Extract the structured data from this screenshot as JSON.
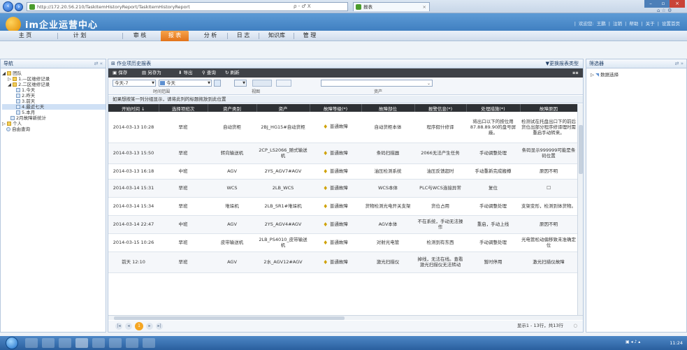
{
  "browser": {
    "address": "http://172.20.56.210/TaskItemHistoryReport/TaskItemHistoryReport",
    "address_controls": "ρ - ♂ X",
    "tab_title": "报表"
  },
  "app": {
    "title": "im企业运营中心",
    "top_links": "| 欢迎您: 王鹏 | 注销 | 帮助 | 关于 | 设置首页"
  },
  "menu": [
    {
      "label": "主 页"
    },
    {
      "label": "计 划"
    },
    {
      "label": "审 核"
    },
    {
      "label": "报 表"
    },
    {
      "label": "分 析"
    },
    {
      "label": "日 志"
    },
    {
      "label": "知识库"
    },
    {
      "label": "管 理"
    }
  ],
  "nav": {
    "title": "导航",
    "tree": [
      {
        "label": "团队"
      },
      {
        "label": "1.—区维修记录"
      },
      {
        "label": "2.二区维修记录"
      },
      {
        "label": "1.今天"
      },
      {
        "label": "2.昨天"
      },
      {
        "label": "3.前天"
      },
      {
        "label": "4.最近七天"
      },
      {
        "label": "5.本月"
      },
      {
        "label": "2月故障新统计"
      },
      {
        "label": "个人"
      },
      {
        "label": "自由查询"
      }
    ]
  },
  "report": {
    "title": "作业项历史报表",
    "change_type": "▼更换报表类型",
    "toolbar": {
      "save": "保存",
      "save_as": "另存为",
      "export": "导出",
      "query": "查询",
      "refresh": "刷新"
    },
    "filters": {
      "from": "今天-7",
      "to": "今天",
      "time_caption": "时间范围",
      "view_caption": "视图",
      "asset_caption": "资产"
    },
    "group_hint": "如果想按某一列分组显示，请将此列的标题拖放到此位置",
    "columns": [
      "开始时间 ↓",
      "选择项班次",
      "资产类别",
      "资产",
      "故障等级(*)",
      "故障部位",
      "报警信息(*)",
      "处理措施(*)",
      "故障原因"
    ],
    "rows": [
      [
        "2014-03-13 10:28",
        "早班",
        "自动货柜",
        "2BJ_HG15#自动货柜",
        "普通故障",
        "自动货柜本体",
        "程序假什修译",
        "将出口以下的按位用87.88.89.90的盘号屏蔽。",
        "检测试在托盘出口下的前后货位出部分程序修译理时需重启手动转来。"
      ],
      [
        "2014-03-13 15:50",
        "早班",
        "转向输送机",
        "2CP_LS2066_随式输送机",
        "普通故障",
        "条码扫描器",
        "2066无法产生任务",
        "手动调整处理",
        "条码显示999999可能是条码位置"
      ],
      [
        "2014-03-13 16:18",
        "中班",
        "AGV",
        "2YS_AGV7#AGV",
        "普通故障",
        "油压检测系统",
        "油压反馈超时",
        "手动重新完成搬樽",
        "原因不明"
      ],
      [
        "2014-03-14 15:31",
        "早班",
        "WCS",
        "2LB_WCS",
        "普通故障",
        "WCS本体",
        "PLC与WCS连接异常",
        "复位",
        "☐"
      ],
      [
        "2014-03-14 15:34",
        "早班",
        "堆垛机",
        "2LB_SR1#堆垛机",
        "普通故障",
        "货物检测光电开关支架",
        "货位占用",
        "手动调整处理",
        "支架变形，检测到体货物。"
      ],
      [
        "2014-03-14 22:47",
        "中班",
        "AGV",
        "2YS_AGV4#AGV",
        "普通故障",
        "AGV本体",
        "不在系统，手动无法操作",
        "重启，手动上线",
        "原因不明"
      ],
      [
        "2014-03-15 10:26",
        "早班",
        "皮带输送机",
        "2LB_PS4010_皮带输送机",
        "普通故障",
        "对射光电管",
        "检测到有东西",
        "手动调整处理",
        "光电管松动偏移致未准确定位"
      ],
      [
        "前天 12:10",
        "早班",
        "AGV",
        "2水_AGV12#AGV",
        "普通故障",
        "激光扫描仪",
        "掉线，无法在线。查看激光扫描仪无法转动",
        "暂时停用",
        "激光扫描仪故障"
      ]
    ],
    "pager_status": "显示1 - 13行，共13行"
  },
  "filter_panel": {
    "title": "筛选器",
    "item": "数据选择"
  },
  "taskbar": {
    "clock": "11:24"
  }
}
